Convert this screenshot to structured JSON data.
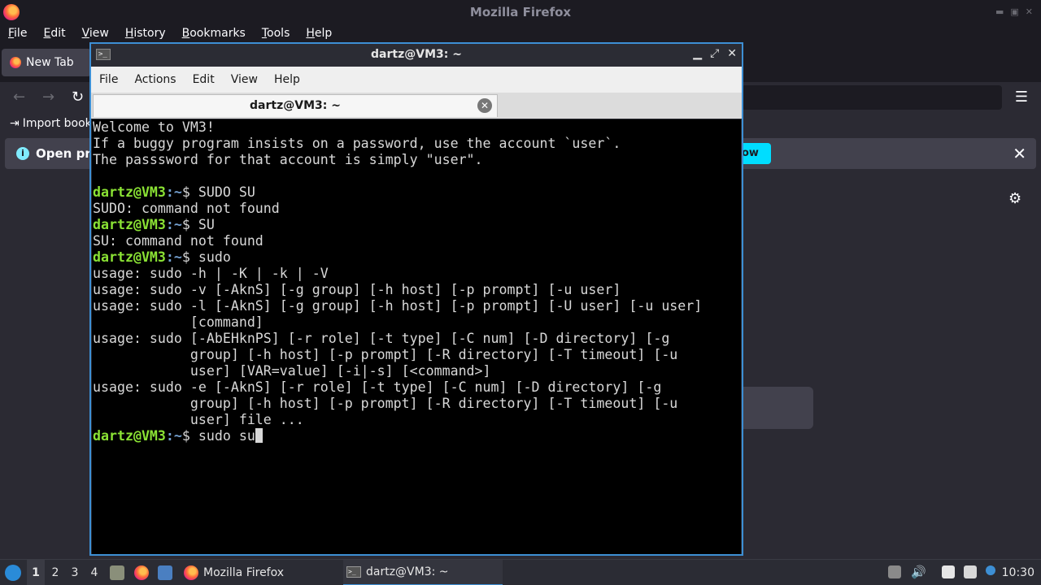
{
  "firefox": {
    "title": "Mozilla Firefox",
    "menu": [
      "File",
      "Edit",
      "View",
      "History",
      "Bookmarks",
      "Tools",
      "Help"
    ],
    "tab_label": "New Tab",
    "bookmark_import": "Import book",
    "notice_text": "Open pre",
    "notice_button": "ow",
    "nav_icons": [
      "back-icon",
      "forward-icon",
      "reload-icon",
      "menu-icon"
    ]
  },
  "terminal": {
    "title": "dartz@VM3: ~",
    "menu": [
      "File",
      "Actions",
      "Edit",
      "View",
      "Help"
    ],
    "tab_label": "dartz@VM3: ~",
    "prompt_user": "dartz@VM3",
    "prompt_path": ":~",
    "prompt_symbol": "$ ",
    "lines": [
      {
        "type": "text",
        "text": "Welcome to VM3!"
      },
      {
        "type": "text",
        "text": "If a buggy program insists on a password, use the account `user`."
      },
      {
        "type": "text",
        "text": "The passsword for that account is simply \"user\"."
      },
      {
        "type": "text",
        "text": ""
      },
      {
        "type": "prompt",
        "cmd": "SUDO SU"
      },
      {
        "type": "text",
        "text": "SUDO: command not found"
      },
      {
        "type": "prompt",
        "cmd": "SU"
      },
      {
        "type": "text",
        "text": "SU: command not found"
      },
      {
        "type": "prompt",
        "cmd": "sudo"
      },
      {
        "type": "text",
        "text": "usage: sudo -h | -K | -k | -V"
      },
      {
        "type": "text",
        "text": "usage: sudo -v [-AknS] [-g group] [-h host] [-p prompt] [-u user]"
      },
      {
        "type": "text",
        "text": "usage: sudo -l [-AknS] [-g group] [-h host] [-p prompt] [-U user] [-u user]"
      },
      {
        "type": "text",
        "text": "            [command]"
      },
      {
        "type": "text",
        "text": "usage: sudo [-AbEHknPS] [-r role] [-t type] [-C num] [-D directory] [-g"
      },
      {
        "type": "text",
        "text": "            group] [-h host] [-p prompt] [-R directory] [-T timeout] [-u"
      },
      {
        "type": "text",
        "text": "            user] [VAR=value] [-i|-s] [<command>]"
      },
      {
        "type": "text",
        "text": "usage: sudo -e [-AknS] [-r role] [-t type] [-C num] [-D directory] [-g"
      },
      {
        "type": "text",
        "text": "            group] [-h host] [-p prompt] [-R directory] [-T timeout] [-u"
      },
      {
        "type": "text",
        "text": "            user] file ..."
      },
      {
        "type": "prompt",
        "cmd": "sudo su",
        "cursor": true
      }
    ]
  },
  "taskbar": {
    "workspaces": [
      "1",
      "2",
      "3",
      "4"
    ],
    "active_workspace": "1",
    "tasks": [
      {
        "label": "Mozilla Firefox",
        "icon": "firefox-icon"
      },
      {
        "label": "dartz@VM3: ~",
        "icon": "terminal-icon",
        "active": true
      }
    ],
    "clock": "10:30"
  },
  "colors": {
    "accent": "#3d8fd4",
    "prompt_user": "#8ae234",
    "prompt_path": "#729fcf",
    "notice_button": "#00ddff"
  }
}
